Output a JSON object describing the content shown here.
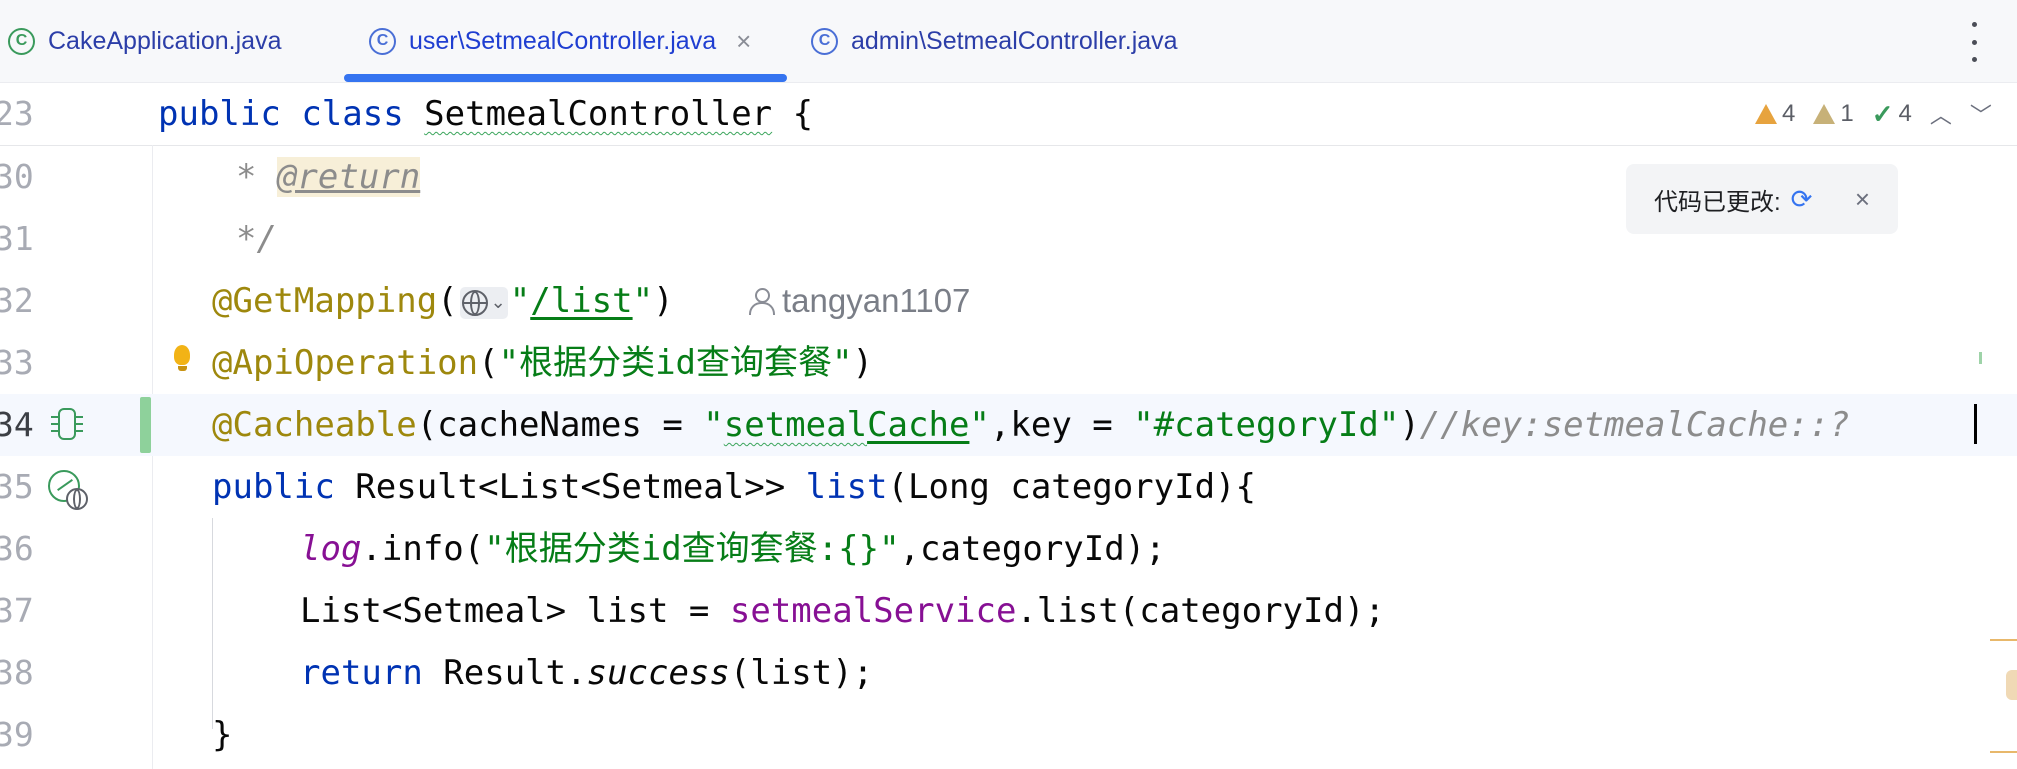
{
  "tabs": [
    {
      "label": "CakeApplication.java",
      "icon": "spring-boot-class-icon",
      "active": false
    },
    {
      "label": "user\\SetmealController.java",
      "icon": "class-icon",
      "active": true,
      "close": "×"
    },
    {
      "label": "admin\\SetmealController.java",
      "icon": "class-icon",
      "active": false
    }
  ],
  "inspections": {
    "warnings": "4",
    "weak_warnings": "1",
    "typos": "4"
  },
  "popup": {
    "label": "代码已更改:",
    "close": "×"
  },
  "lines": [
    {
      "num": "23"
    },
    {
      "num": "30"
    },
    {
      "num": "31"
    },
    {
      "num": "32"
    },
    {
      "num": "33"
    },
    {
      "num": "34"
    },
    {
      "num": "35"
    },
    {
      "num": "36"
    },
    {
      "num": "37"
    },
    {
      "num": "38"
    },
    {
      "num": "39"
    }
  ],
  "code": {
    "l23": {
      "kw1": "public",
      "kw2": "class",
      "name": "SetmealController",
      "rest": " {"
    },
    "l30": {
      "star": "* ",
      "tag": "@return"
    },
    "l31": {
      "text": "*/"
    },
    "l32": {
      "ann": "@GetMapping",
      "open": "(",
      "str_open": "\"",
      "path": "/list",
      "str_close": "\"",
      "close": ")"
    },
    "l33": {
      "ann": "@ApiOperation",
      "open": "(",
      "str": "\"根据分类id查询套餐\"",
      "close": ")"
    },
    "l34": {
      "ann": "@Cacheable",
      "p1": "(cacheNames = ",
      "s1q": "\"",
      "s1a": "setmeal",
      "s1b": "Cache",
      "s1c": "\"",
      "p2": ",key = ",
      "s2": "\"#categoryId\"",
      "p3": ")",
      "comment": "//key:setmealCache::?"
    },
    "l35": {
      "kw": "public",
      "type": " Result<List<Setmeal>> ",
      "method": "list",
      "rest": "(Long categoryId){"
    },
    "l36": {
      "fld": "log",
      "mid": ".info(",
      "str": "\"根据分类id查询套餐:{}\"",
      "rest": ",categoryId);"
    },
    "l37": {
      "pre": "List<Setmeal> list = ",
      "fld": "setmealService",
      "rest": ".list(categoryId);"
    },
    "l38": {
      "kw": "return",
      "pre": " Result.",
      "method": "success",
      "rest": "(list);"
    },
    "l39": {
      "text": "}"
    }
  },
  "author": "tangyan1107",
  "colors": {
    "keyword": "#0033b3",
    "annotation": "#9e880d",
    "string": "#067d17",
    "comment": "#8c8c8c",
    "field": "#871094",
    "tab_accent": "#3574f0"
  }
}
